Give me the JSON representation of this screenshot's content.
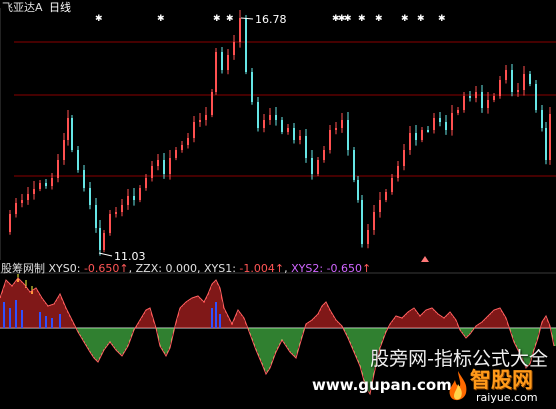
{
  "header": {
    "stock_name": "飞亚达A",
    "period": "日线"
  },
  "price_panel": {
    "high_label": "16.78",
    "low_label": "11.03",
    "top_marker_glyph": "✱",
    "top_marker_count": 13
  },
  "indicator_panel": {
    "name": "股筹网制",
    "xys0_label": "XYS0:",
    "xys0_value": "-0.650",
    "zzx_label": "ZZX:",
    "zzx_value": "0.000",
    "xys1_label": "XYS1:",
    "xys1_value": "-1.004",
    "xys2_label": "XYS2:",
    "xys2_value": "-0.650",
    "up_arrow": "↑",
    "separator": ","
  },
  "watermark": {
    "tagline": "股旁网-指标公式大全",
    "site": "www.gupan.com",
    "brand": "智股网",
    "brand_domain": "raiyue.com"
  },
  "colors": {
    "background": "#000000",
    "up_candle": "#ff5050",
    "down_candle": "#66e6e6",
    "gridline": "#8a0000",
    "positive_bar": "#ff3030",
    "negative_bar": "#60ff60",
    "blue_bar": "#3050ff",
    "xys2": "#d066ff"
  },
  "chart_data": [
    {
      "type": "candlestick",
      "title": "飞亚达A 日线",
      "ylim": [
        11.03,
        16.78
      ],
      "annotations": [
        {
          "text": "16.78",
          "kind": "high"
        },
        {
          "text": "11.03",
          "kind": "low"
        }
      ]
    },
    {
      "type": "bar",
      "title": "股筹网制",
      "series": [
        {
          "name": "XYS0",
          "last": -0.65
        },
        {
          "name": "ZZX",
          "last": 0.0
        },
        {
          "name": "XYS1",
          "last": -1.004
        },
        {
          "name": "XYS2",
          "last": -0.65
        }
      ]
    }
  ]
}
